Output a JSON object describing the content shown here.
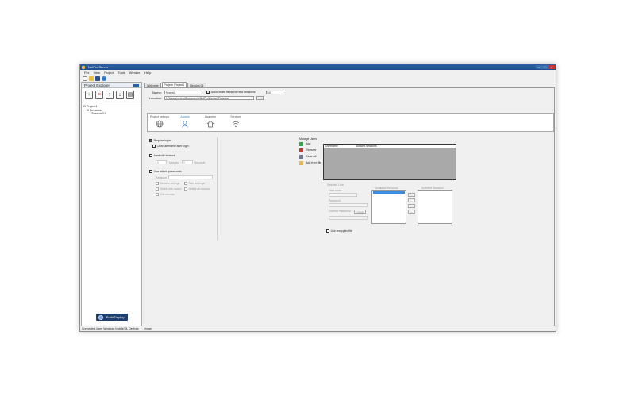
{
  "app": {
    "title": "NetPro Server"
  },
  "menu": [
    "File",
    "View",
    "Project",
    "Tools",
    "Window",
    "Help"
  ],
  "explorer": {
    "title": "Project Explorer",
    "tools": [
      "+",
      "×",
      "↑",
      "↓",
      "▤"
    ],
    "tree": [
      "Project1",
      "Sessions",
      "Session 01"
    ],
    "build_label": "Build/Deploy"
  },
  "tabs": [
    "Welcome",
    "Project: Project1",
    "Session 01"
  ],
  "project": {
    "name_label": "Name:",
    "name_value": "Project1",
    "location_label": "Location:",
    "location_value": "C:\\Users\\netpro\\Documents\\NetPro\\Deploy\\Projects\\",
    "browse_label": "...",
    "auto_label": "Auto create fields for new sessions:",
    "auto_value": "10"
  },
  "ptabs": [
    "Project settings",
    "Access",
    "Launcher",
    "Services"
  ],
  "access": {
    "require_login": "Require login",
    "clear_username": "Clear username after login",
    "inactivity": "Inactivity timeout",
    "minutes": "Minutes",
    "seconds": "Seconds",
    "minutes_value": "0",
    "seconds_value": "0",
    "use_admin": "Use admin passwords",
    "password_label": "Password",
    "opts": [
      "Session settings",
      "Field settings",
      "Delete one record",
      "Delete all records",
      "Edit records"
    ]
  },
  "users": {
    "title": "Manage Users",
    "buttons": [
      "Add",
      "Remove",
      "Clear All",
      "Add from file"
    ],
    "col_user": "Username",
    "col_sessions": "Allowed Sessions",
    "details_title": "Selected User",
    "username_label": "User name",
    "password_label": "Password",
    "confirm_label": "Confirm Password",
    "update_label": "Update",
    "available_label": "Available Sessions",
    "selected_label": "Selected Sessions",
    "use_encrypted": "Use encrypted file"
  },
  "status": {
    "text": "Connected User: Windows Mobile/QL Devices",
    "value": "(none)"
  }
}
